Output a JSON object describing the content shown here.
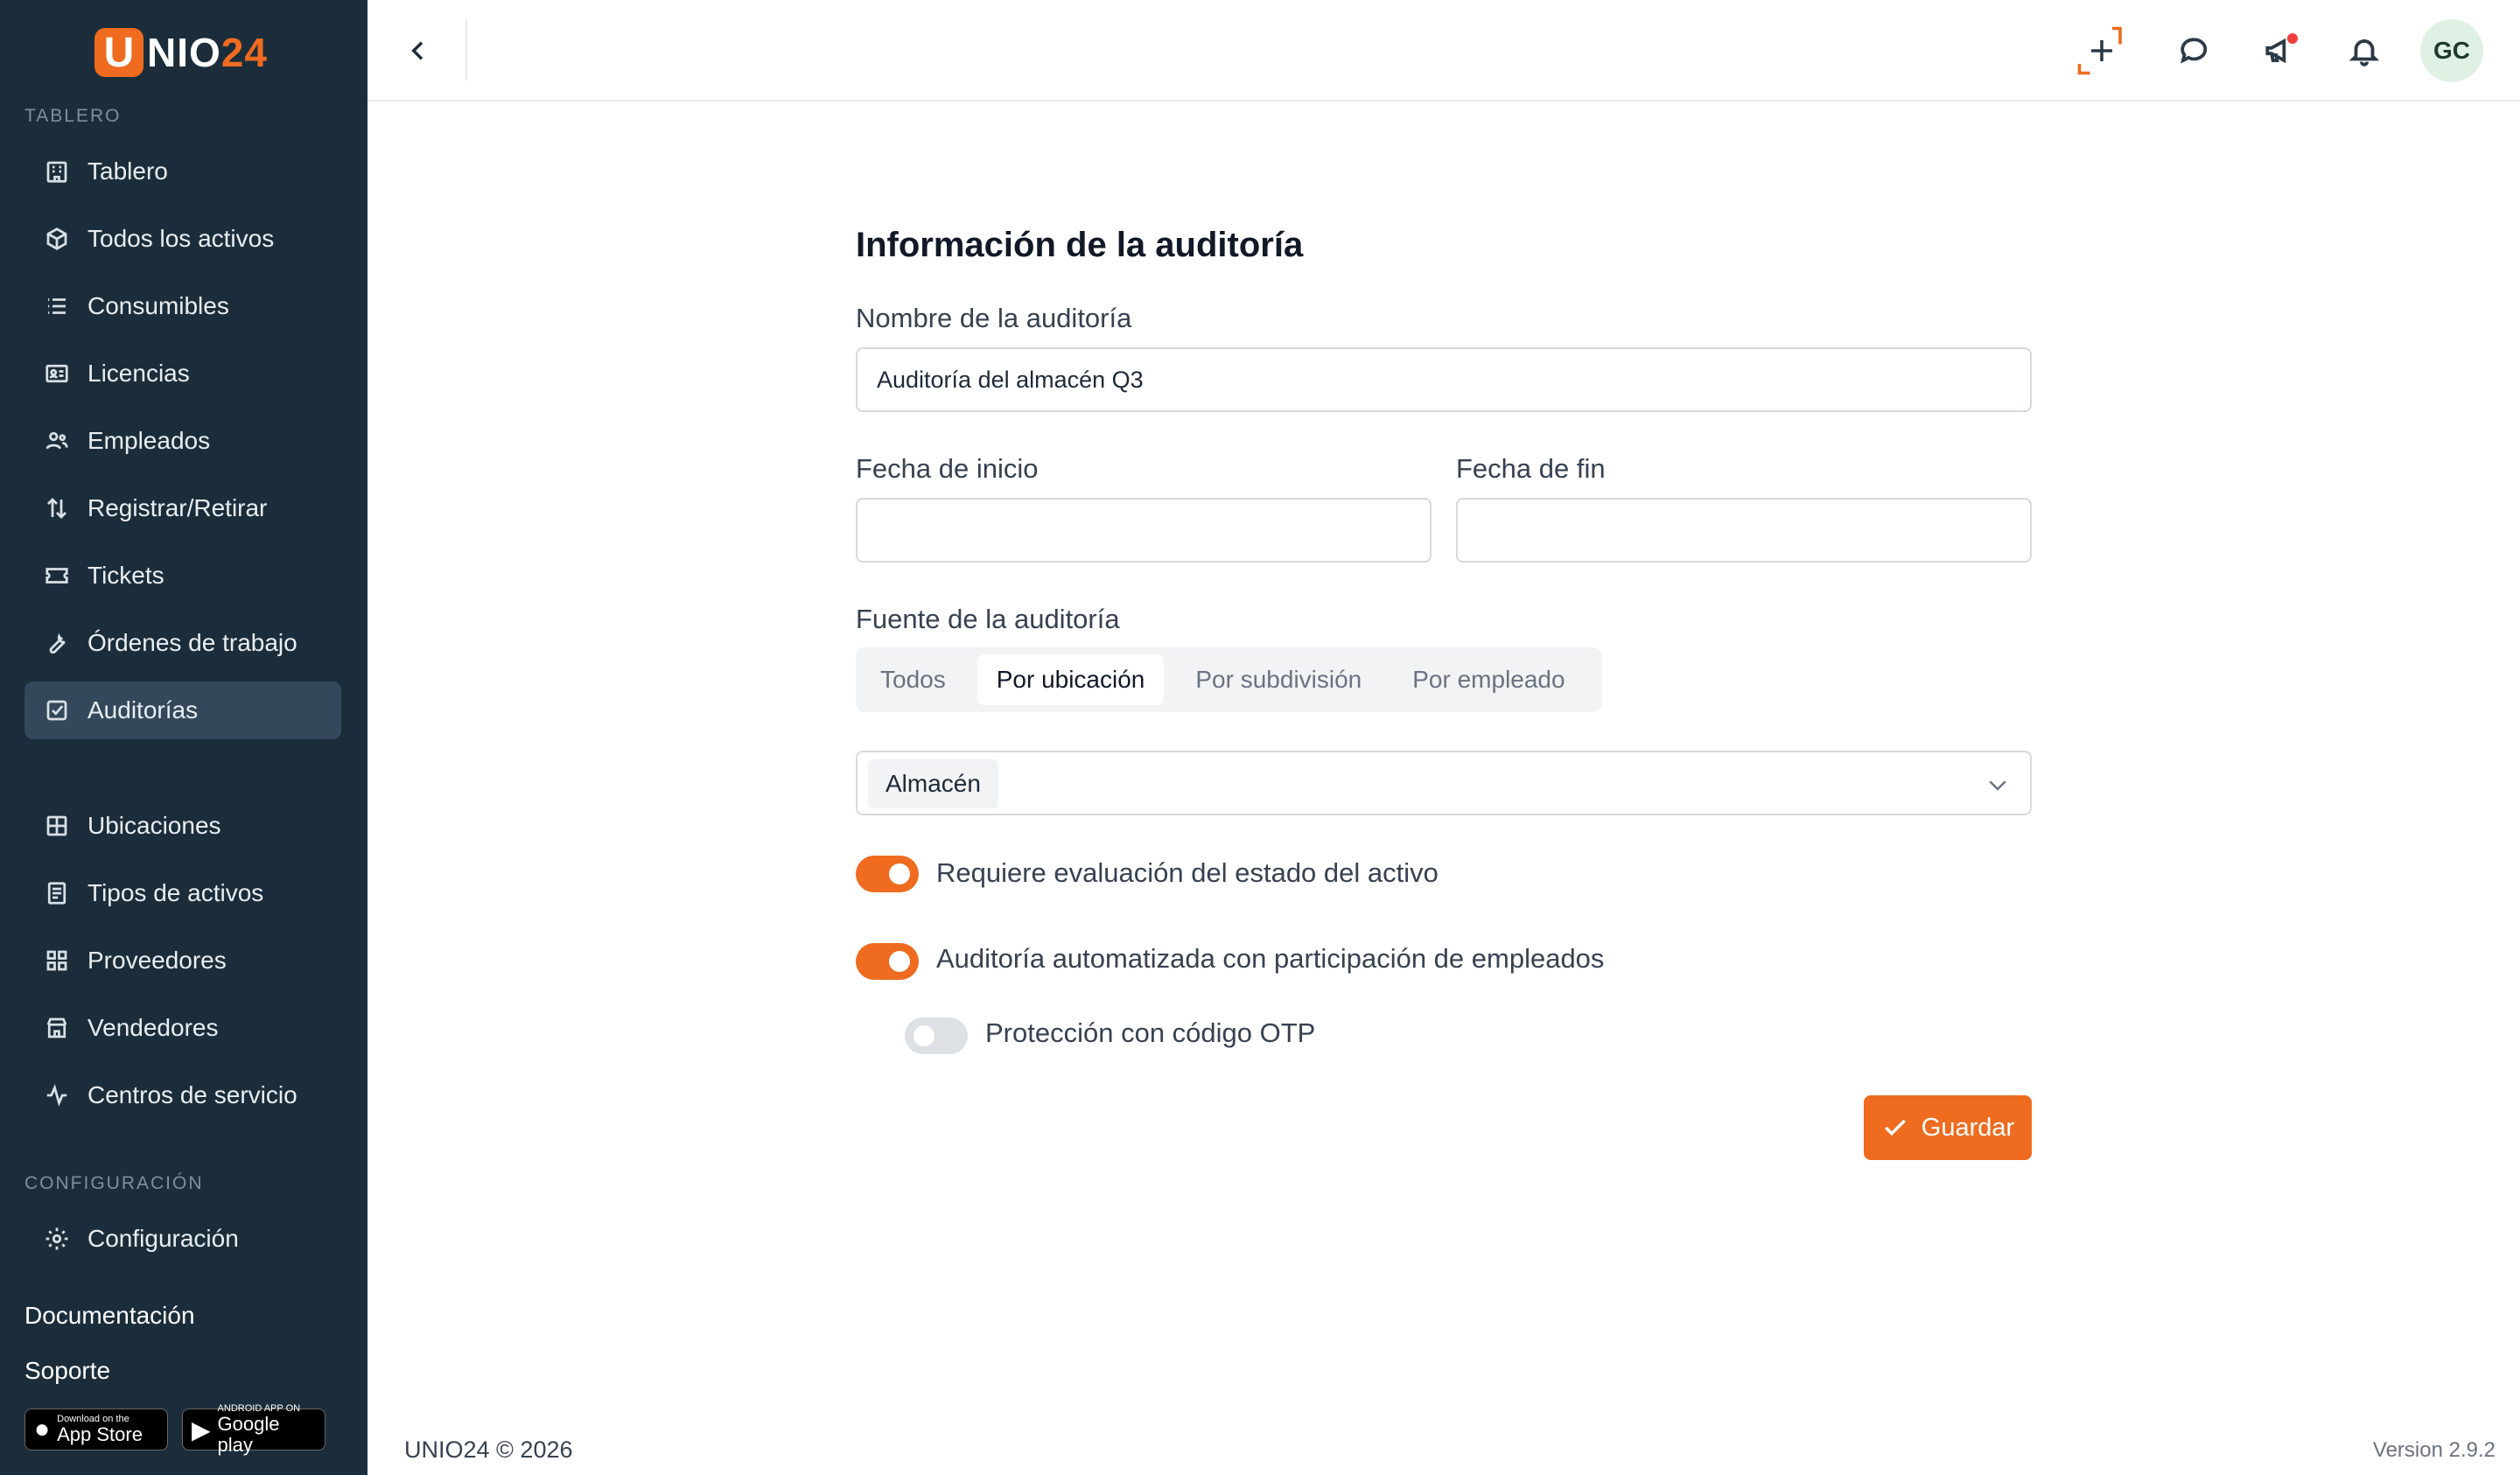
{
  "brand": {
    "logo_letter": "U",
    "logo_rest": "NIO",
    "logo_num": "24",
    "accent_color": "#ee6b1f"
  },
  "sidebar": {
    "section_dashboard": "TABLERO",
    "section_config": "CONFIGURACIÓN",
    "items": [
      {
        "label": "Tablero",
        "icon": "building-icon"
      },
      {
        "label": "Todos los activos",
        "icon": "cube-icon"
      },
      {
        "label": "Consumibles",
        "icon": "list-icon"
      },
      {
        "label": "Licencias",
        "icon": "id-card-icon"
      },
      {
        "label": "Empleados",
        "icon": "users-icon"
      },
      {
        "label": "Registrar/Retirar",
        "icon": "arrows-updown-icon"
      },
      {
        "label": "Tickets",
        "icon": "ticket-icon"
      },
      {
        "label": "Órdenes de trabajo",
        "icon": "wrench-icon"
      },
      {
        "label": "Auditorías",
        "icon": "checkbox-icon",
        "active": true
      },
      {
        "label": "Ubicaciones",
        "icon": "grid-icon"
      },
      {
        "label": "Tipos de activos",
        "icon": "document-icon"
      },
      {
        "label": "Proveedores",
        "icon": "apps-icon"
      },
      {
        "label": "Vendedores",
        "icon": "store-icon"
      },
      {
        "label": "Centros de servicio",
        "icon": "activity-icon"
      }
    ],
    "config_item": {
      "label": "Configuración",
      "icon": "gear-icon"
    },
    "documentation": "Documentación",
    "support": "Soporte",
    "app_store": {
      "small": "Download on the",
      "large": "App Store"
    },
    "google_play": {
      "small": "ANDROID APP ON",
      "large": "Google play"
    }
  },
  "topbar": {
    "avatar_initials": "GC"
  },
  "form": {
    "title": "Información de la auditoría",
    "name_label": "Nombre de la auditoría",
    "name_value": "Auditoría del almacén Q3",
    "start_label": "Fecha de inicio",
    "start_value": "",
    "end_label": "Fecha de fin",
    "end_value": "",
    "source_label": "Fuente de la auditoría",
    "source_tabs": [
      "Todos",
      "Por ubicación",
      "Por subdivisión",
      "Por empleado"
    ],
    "source_selected": "Por ubicación",
    "location_chip": "Almacén",
    "toggles": [
      {
        "label": "Requiere evaluación del estado del activo",
        "on": true
      },
      {
        "label": "Auditoría automatizada con participación de empleados",
        "on": true
      },
      {
        "label": "Protección con código OTP",
        "on": false
      }
    ],
    "save_label": "Guardar"
  },
  "footer": {
    "copyright": "UNIO24 © 2026",
    "version": "Version 2.9.2"
  }
}
